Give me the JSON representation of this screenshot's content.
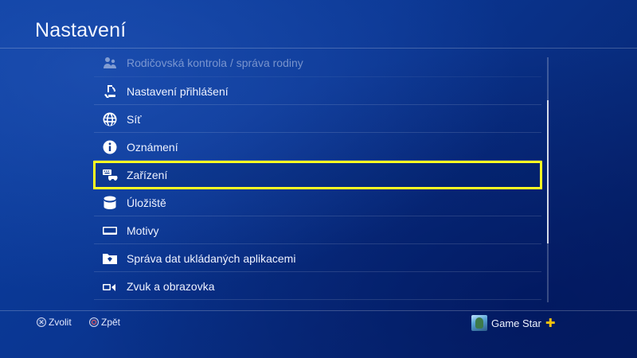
{
  "header": {
    "title": "Nastavení"
  },
  "menu": {
    "items": [
      {
        "label": "Rodičovská kontrola / správa rodiny",
        "icon": "parental-control-icon"
      },
      {
        "label": "Nastavení přihlášení",
        "icon": "login-icon"
      },
      {
        "label": "Síť",
        "icon": "globe-icon"
      },
      {
        "label": "Oznámení",
        "icon": "info-icon"
      },
      {
        "label": "Zařízení",
        "icon": "devices-icon",
        "selected": true
      },
      {
        "label": "Úložiště",
        "icon": "storage-icon"
      },
      {
        "label": "Motivy",
        "icon": "theme-icon"
      },
      {
        "label": "Správa dat ukládaných aplikacemi",
        "icon": "folder-icon"
      },
      {
        "label": "Zvuk a obrazovka",
        "icon": "sound-screen-icon"
      }
    ]
  },
  "footer": {
    "confirm_label": "Zvolit",
    "back_label": "Zpět",
    "user_name": "Game Star"
  },
  "colors": {
    "selection": "#ffff22",
    "plus": "#f4c20d",
    "background": "#0a3692"
  }
}
